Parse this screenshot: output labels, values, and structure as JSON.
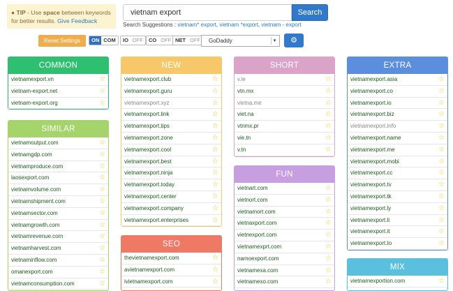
{
  "tip": {
    "prefix": "TIP",
    "text1": " - Use ",
    "bold": "space",
    "text2": " between keywords for better results. ",
    "link": "Give Feedback"
  },
  "search": {
    "value": "vietnam export",
    "button": "Search"
  },
  "suggestions": {
    "label": "Search Suggestions : ",
    "items": [
      "vietnam* export",
      "vietnam *export",
      "vietnam - export"
    ],
    "sep": ", "
  },
  "controls": {
    "reset": "Reset Settings",
    "com": {
      "on": "ON",
      "label": "COM"
    },
    "io": {
      "label": "IO",
      "off": "OFF"
    },
    "co": {
      "label": "CO",
      "off": "OFF"
    },
    "net": {
      "label": "NET",
      "off": "OFF"
    },
    "registrar": "GoDaddy"
  },
  "panels": {
    "common": {
      "title": "COMMON",
      "color": "#2fbf71",
      "items": [
        "vietnamexport.vn",
        "vietnam-export.net",
        "vietnam-export.org"
      ]
    },
    "similar": {
      "title": "SIMILAR",
      "color": "#a4d46a",
      "items": [
        "vietnamoutput.com",
        "vietnamgdp.com",
        "vietnamproduce.com",
        "laosexport.com",
        "vietnamvolume.com",
        "vietnamshipment.com",
        "vietnamsector.com",
        "vietnamgrowth.com",
        "vietnamrevenue.com",
        "vietnamharvest.com",
        "vietnaminflow.com",
        "omanexport.com",
        "vietnamconsumption.com"
      ]
    },
    "new": {
      "title": "NEW",
      "color": "#f7c86a",
      "items": [
        "vietnamexport.club",
        "vietnamexport.guru",
        "vietnamexport.xyz",
        "vietnamexport.link",
        "vietnamexport.tips",
        "vietnamexport.zone",
        "vietnamexport.cool",
        "vietnamexport.best",
        "vietnamexport.ninja",
        "vietnamexport.today",
        "vietnamexport.center",
        "vietnamexport.company",
        "vietnamexport.enterprises"
      ]
    },
    "seo": {
      "title": "SEO",
      "color": "#ee7a66",
      "items": [
        "thevietnamexport.com",
        "avietnamexport.com",
        "ivietnamexport.com"
      ]
    },
    "short": {
      "title": "SHORT",
      "color": "#dba3c8",
      "items": [
        "v.ie",
        "vtn.mx",
        "vietna.me",
        "viet.na",
        "vtnmx.pr",
        "vie.tn",
        "v.tn"
      ]
    },
    "fun": {
      "title": "FUN",
      "color": "#c79fe0",
      "items": [
        "vietnart.com",
        "vietnort.com",
        "vietnamort.com",
        "vietnaxport.com",
        "vietnexport.com",
        "vietnamexprt.com",
        "namoexport.com",
        "vietnamexa.com",
        "vietnamexo.com"
      ]
    },
    "extra": {
      "title": "EXTRA",
      "color": "#5b8fde",
      "items": [
        "vietnamexport.asia",
        "vietnamexport.co",
        "vietnamexport.io",
        "vietnamexport.biz",
        "vietnamexport.info",
        "vietnamexport.name",
        "vietnamexport.me",
        "vietnamexport.mobi",
        "vietnamexport.cc",
        "vietnamexport.tv",
        "vietnamexport.tk",
        "vietnamexport.ly",
        "vietnamexport.li",
        "vietnamexport.it",
        "vietnamexport.to"
      ]
    },
    "mix": {
      "title": "MIX",
      "color": "#5bc0de",
      "items": [
        "vietnamexportion.com"
      ]
    }
  },
  "taken_flags": {
    "new": [
      false,
      false,
      true,
      false,
      false,
      false,
      false,
      false,
      false,
      false,
      false,
      false,
      false
    ],
    "short": [
      true,
      false,
      true,
      false,
      false,
      false,
      false
    ],
    "extra": [
      false,
      false,
      false,
      false,
      true,
      false,
      false,
      false,
      false,
      false,
      false,
      false,
      false,
      false,
      false
    ]
  },
  "star_icon": "star-outline-icon"
}
